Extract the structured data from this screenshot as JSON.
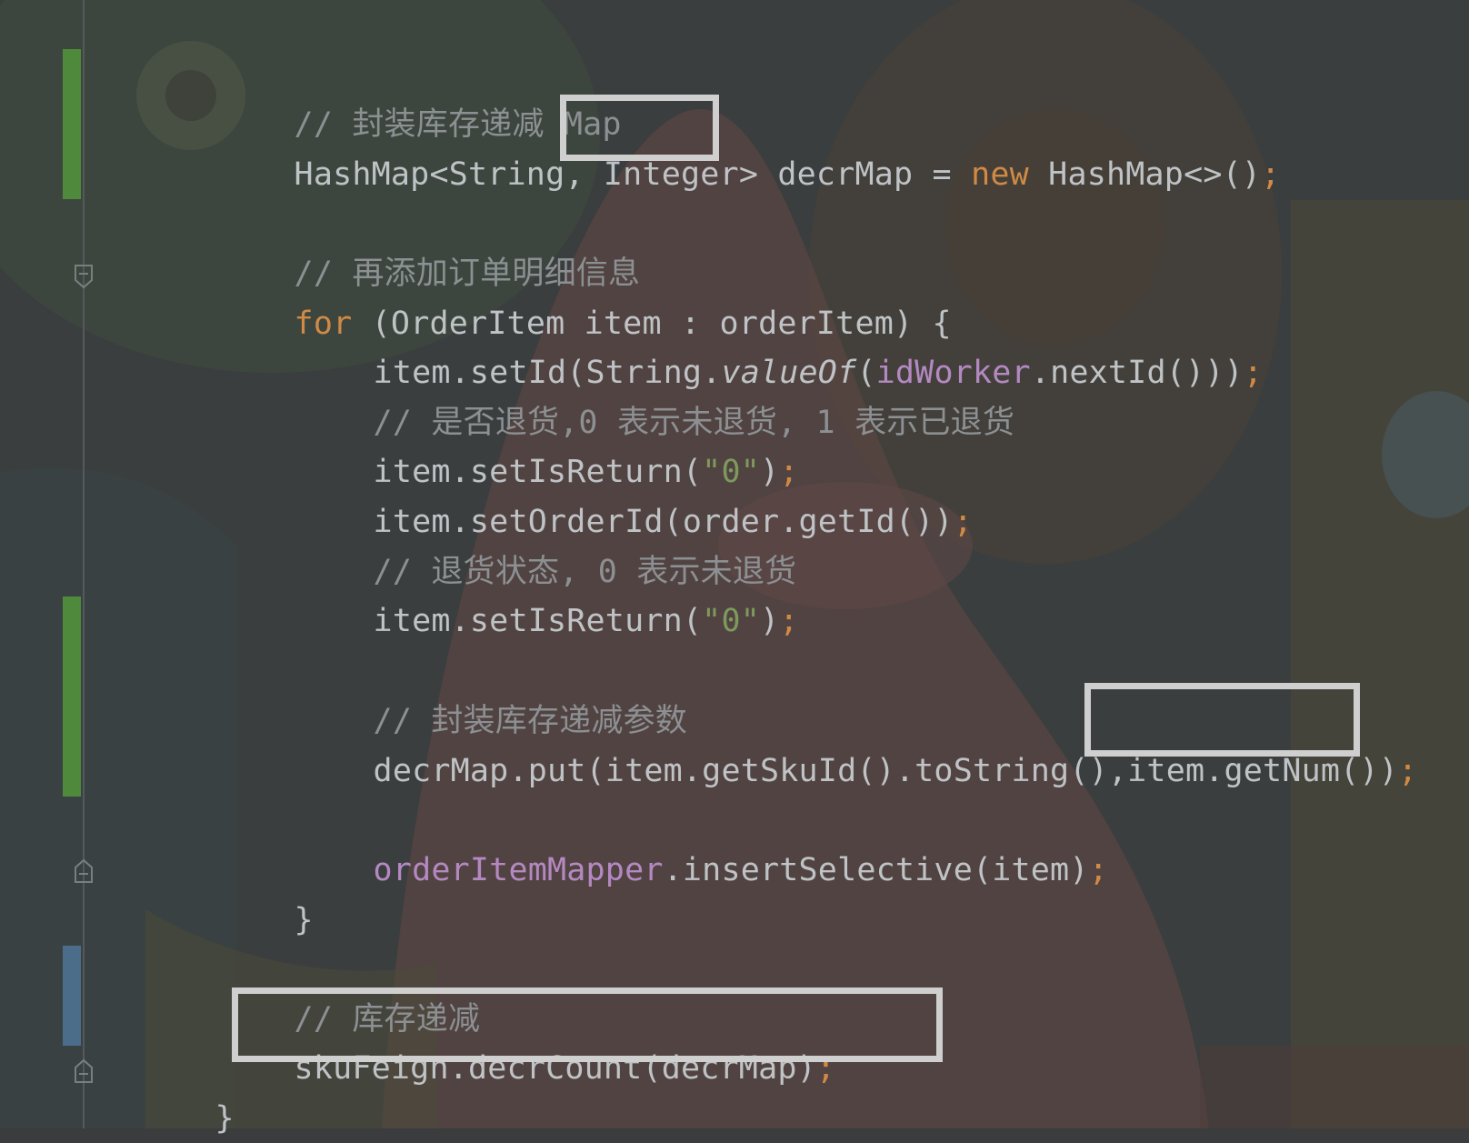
{
  "editor": {
    "lines": {
      "l1": {
        "comment": "// 封装库存递减 Map"
      },
      "l2": {
        "t1": "HashMap<String, ",
        "t2": "Integer",
        "t3": "> decrMap = ",
        "kw": "new",
        "t4": " HashMap<>()",
        "semi": ";"
      },
      "l3": {
        "comment": "// 再添加订单明细信息"
      },
      "l4": {
        "kw": "for",
        "t1": " (OrderItem item : orderItem) {"
      },
      "l5": {
        "t1": "item.setId(String.",
        "ital": "valueOf",
        "t2": "(",
        "fld": "idWorker",
        "t3": ".nextId()))",
        "semi": ";"
      },
      "l6": {
        "comment": "// 是否退货,0 表示未退货, 1 表示已退货"
      },
      "l7": {
        "t1": "item.setIsReturn(",
        "str": "\"0\"",
        "t2": ")",
        "semi": ";"
      },
      "l8": {
        "t1": "item.setOrderId(order.getId())",
        "semi": ";"
      },
      "l9": {
        "comment": "// 退货状态, 0 表示未退货"
      },
      "l10": {
        "t1": "item.setIsReturn(",
        "str": "\"0\"",
        "t2": ")",
        "semi": ";"
      },
      "l11": {
        "comment": "// 封装库存递减参数"
      },
      "l12": {
        "t1": "decrMap.put(item.getSkuId().toString(),",
        "t2": "item.getNum()",
        "t3": ")",
        "semi": ";"
      },
      "l13": {
        "fld": "orderItemMapper",
        "t1": ".insertSelective(item)",
        "semi": ";"
      },
      "l14": {
        "t1": "}"
      },
      "l15": {
        "comment": "// 库存递减"
      },
      "l16": {
        "t1": "skuFeign.decrCount(decrMap)",
        "semi": ";"
      },
      "l17": {
        "t1": "}"
      }
    }
  },
  "colors": {
    "keyword": "#d08a45",
    "comment": "#8c9093",
    "string": "#7d9a5c",
    "field": "#b489c2",
    "text": "#bfc3c6",
    "highlight_box": "#cfcfcf",
    "change_added": "#4f8a3c",
    "change_modified": "#4c6d8a"
  }
}
